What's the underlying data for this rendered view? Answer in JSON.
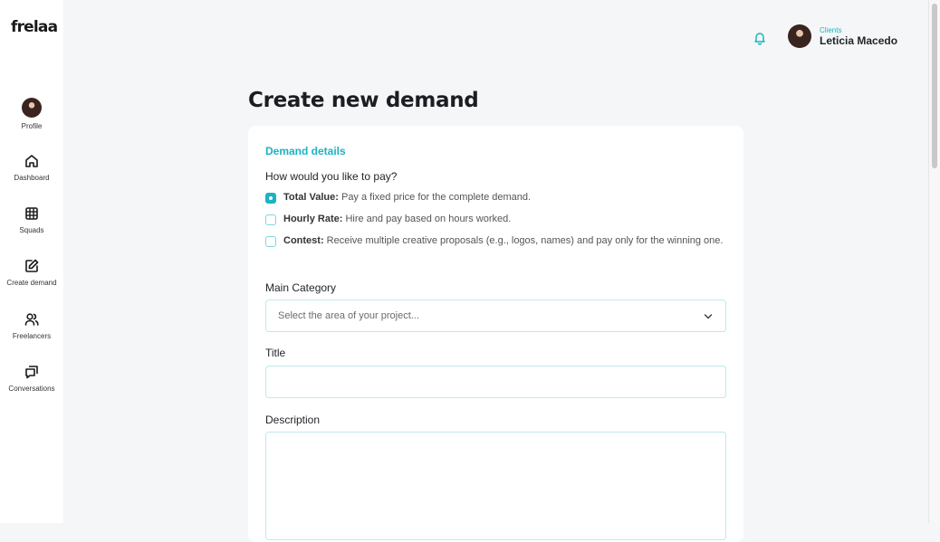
{
  "brand": {
    "logo": "frelaa"
  },
  "sidebar": {
    "items": [
      {
        "label": "Profile",
        "icon": "avatar"
      },
      {
        "label": "Dashboard",
        "icon": "home-icon"
      },
      {
        "label": "Squads",
        "icon": "grid-icon"
      },
      {
        "label": "Create demand",
        "icon": "edit-icon"
      },
      {
        "label": "Freelancers",
        "icon": "users-icon"
      },
      {
        "label": "Conversations",
        "icon": "chat-icon"
      }
    ]
  },
  "header": {
    "user_role": "Clients",
    "user_name": "Leticia Macedo",
    "notification_icon": "bell-icon"
  },
  "page": {
    "title": "Create new demand"
  },
  "form": {
    "section_title": "Demand details",
    "payment_question": "How would you like to pay?",
    "payment_options": [
      {
        "title": "Total Value:",
        "desc": " Pay a fixed price for the complete demand.",
        "checked": true
      },
      {
        "title": "Hourly Rate:",
        "desc": " Hire and pay based on hours worked.",
        "checked": false
      },
      {
        "title": "Contest:",
        "desc": " Receive multiple creative proposals (e.g., logos, names) and pay only for the winning one.",
        "checked": false
      }
    ],
    "category": {
      "label": "Main Category",
      "placeholder": "Select the area of your project..."
    },
    "title_field": {
      "label": "Title",
      "value": ""
    },
    "description_field": {
      "label": "Description",
      "value": ""
    }
  },
  "colors": {
    "accent": "#1ab4c2",
    "background": "#f4f6f7",
    "border": "#bfe9ee"
  }
}
